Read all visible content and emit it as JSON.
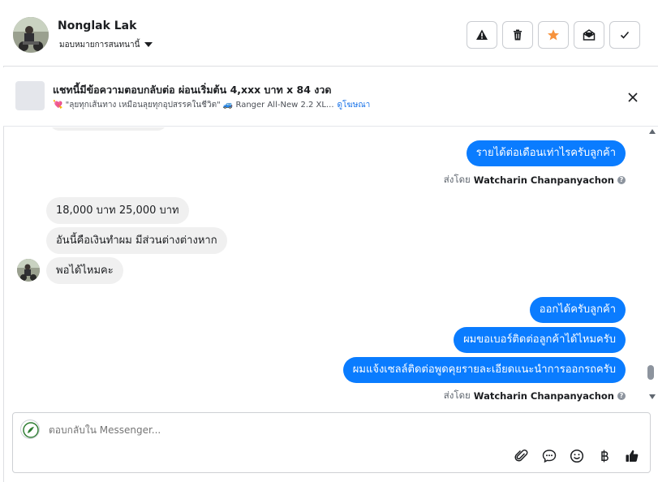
{
  "header": {
    "contact_name": "Nonglak Lak",
    "assign_label": "มอบหมายการสนทนานี้",
    "actions": [
      {
        "name": "report-button",
        "icon": "warning-icon"
      },
      {
        "name": "delete-button",
        "icon": "trash-icon"
      },
      {
        "name": "star-button",
        "icon": "star-icon",
        "color": "#f7923b"
      },
      {
        "name": "mark-unread-button",
        "icon": "envelope-open-icon"
      },
      {
        "name": "mark-done-button",
        "icon": "check-icon"
      }
    ]
  },
  "ad": {
    "title": "แชทนี้มีข้อความตอบกลับต่อ ผ่อนเริ่มต้น 4,xxx บาท x 84 งวด",
    "subtitle": "💘 \"ลุยทุกเส้นทาง เหมือนลุยทุกอุปสรรคในชีวิต\" 🚙 Ranger All-New 2.2 XL...",
    "link_label": "ดูโฆษณา"
  },
  "messages": {
    "out_1": "รายได้ต่อเดือนเท่าไรครับลูกค้า",
    "sent_by_prefix": "ส่งโดย",
    "agent_name": "Watcharin Chanpanyachon",
    "in_1": "18,000 บาท 25,000 บาท",
    "in_2": "อันนี้คือเงินทำผม มีส่วนต่างต่างหาก",
    "in_3": "พอได้ไหมคะ",
    "out_2": "ออกได้ครับลูกค้า",
    "out_3": "ผมขอเบอร์ติดต่อลูกค้าได้ไหมครับ",
    "out_4": "ผมแจ้งเซลล์ติดต่อพูดคุยรายละเอียดแนะนำการออกรถครับ"
  },
  "composer": {
    "placeholder": "ตอบกลับใน Messenger...",
    "tools": [
      "attachment-icon",
      "saved-replies-icon",
      "emoji-icon",
      "baht-payment-icon",
      "thumbs-up-icon"
    ]
  },
  "colors": {
    "outgoing_bubble": "#0a7cff",
    "incoming_bubble": "#f0f0f0",
    "link": "#1a73e8"
  }
}
